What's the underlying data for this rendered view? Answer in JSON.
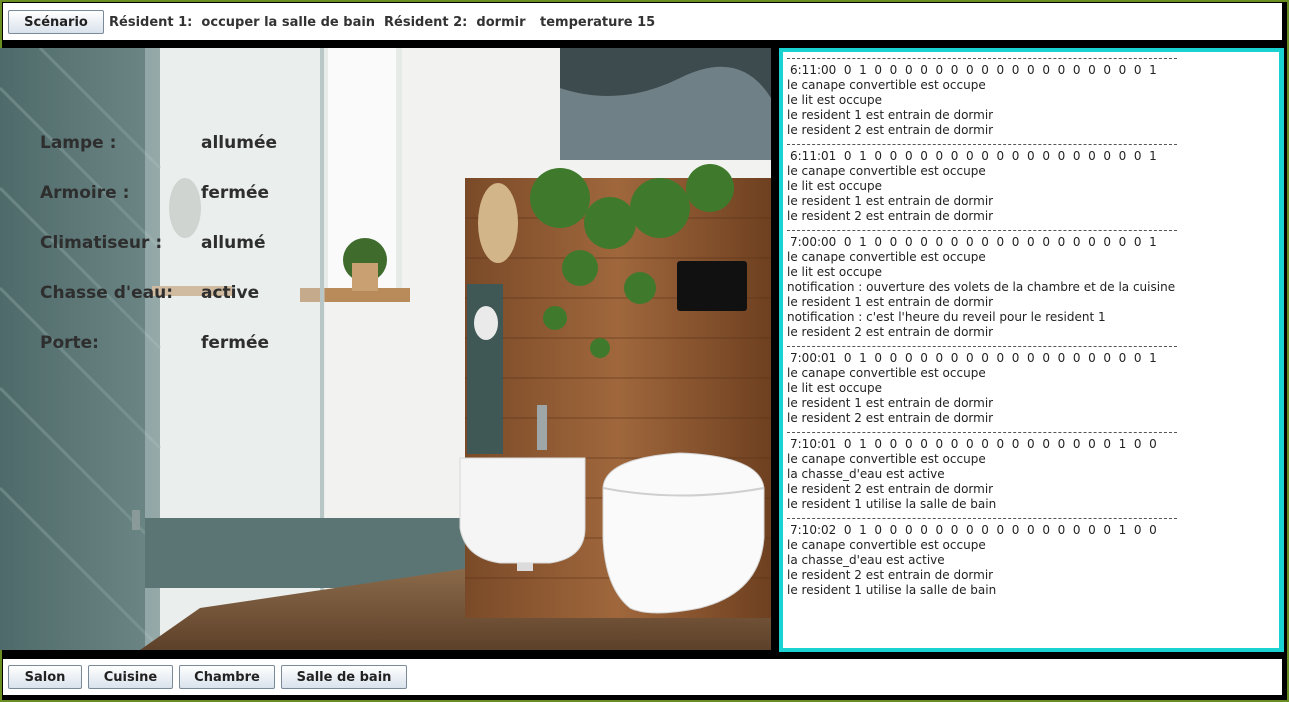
{
  "topbar": {
    "scenario_label": "Scénario",
    "resident1": "Résident 1:  occuper la salle de bain",
    "resident2": "Résident 2:  dormir",
    "temperature": "temperature 15"
  },
  "status": [
    {
      "label": "Lampe :",
      "value": "allumée"
    },
    {
      "label": "Armoire :",
      "value": "fermée"
    },
    {
      "label": "Climatiseur :",
      "value": "allumé"
    },
    {
      "label": "Chasse d'eau:",
      "value": "active"
    },
    {
      "label": "Porte:",
      "value": "fermée"
    }
  ],
  "log": [
    {
      "head": "6:11:00  0  1  0  0  0  0  0  0  0  0  0  0  0  0  0  0  0  0  0  0  1",
      "lines": [
        "le canape convertible est occupe",
        "le lit est occupe",
        "le resident 1 est entrain de dormir",
        "le resident 2 est entrain de dormir"
      ]
    },
    {
      "head": "6:11:01  0  1  0  0  0  0  0  0  0  0  0  0  0  0  0  0  0  0  0  0  1",
      "lines": [
        "le canape convertible est occupe",
        "le lit est occupe",
        "le resident 1 est entrain de dormir",
        "le resident 2 est entrain de dormir"
      ]
    },
    {
      "head": "7:00:00  0  1  0  0  0  0  0  0  0  0  0  0  0  0  0  0  0  0  0  0  1",
      "lines": [
        "le canape convertible est occupe",
        "le lit est occupe",
        "notification : ouverture des volets de la chambre et de la cuisine",
        "le resident 1 est entrain de dormir",
        "notification : c'est l'heure du reveil pour le resident 1",
        "le resident 2 est entrain de dormir"
      ]
    },
    {
      "head": "7:00:01  0  1  0  0  0  0  0  0  0  0  0  0  0  0  0  0  0  0  0  0  1",
      "lines": [
        "le canape convertible est occupe",
        "le lit est occupe",
        "le resident 1 est entrain de dormir",
        "le resident 2 est entrain de dormir"
      ]
    },
    {
      "head": "7:10:01  0  1  0  0  0  0  0  0  0  0  0  0  0  0  0  0  0  0  1  0  0",
      "lines": [
        "le canape convertible est occupe",
        "la chasse_d'eau est active",
        "le resident 2 est entrain de dormir",
        "le resident 1 utilise la salle de bain"
      ]
    },
    {
      "head": "7:10:02  0  1  0  0  0  0  0  0  0  0  0  0  0  0  0  0  0  0  1  0  0",
      "lines": [
        "le canape convertible est occupe",
        "la chasse_d'eau est active",
        "le resident 2 est entrain de dormir",
        "le resident 1 utilise la salle de bain"
      ]
    }
  ],
  "rooms": [
    "Salon",
    "Cuisine",
    "Chambre",
    "Salle de bain"
  ]
}
